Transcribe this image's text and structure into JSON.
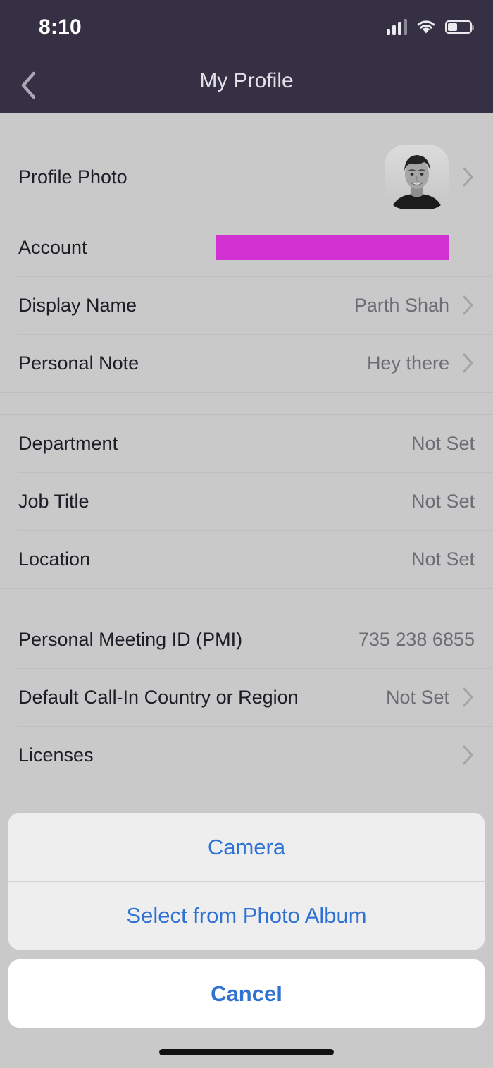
{
  "status_bar": {
    "time": "8:10",
    "icons": [
      "cellular-signal-icon",
      "wifi-icon",
      "battery-icon"
    ],
    "battery_level_percent": 38
  },
  "nav_bar": {
    "title": "My Profile",
    "back_icon": "chevron-left-icon",
    "background_color": "#353043",
    "title_color": "#e3e1e8"
  },
  "colors": {
    "page_background": "#c9c9ca",
    "row_label": "#1d1d26",
    "row_value": "#6c6c74",
    "separator": "#bfbfc1",
    "redaction": "#d031d0",
    "action_link": "#2f72d4",
    "sheet_background": "#eeeeef",
    "cancel_background": "#ffffff"
  },
  "sections": [
    {
      "name": "profile",
      "rows": [
        {
          "label": "Profile Photo",
          "value": "",
          "value_type": "avatar",
          "avatar_alt": "user-profile-photo",
          "chevron": true
        },
        {
          "label": "Account",
          "value": "",
          "value_type": "redacted",
          "chevron": false
        },
        {
          "label": "Display Name",
          "value": "Parth Shah",
          "value_type": "text",
          "chevron": true
        },
        {
          "label": "Personal Note",
          "value": "Hey there",
          "value_type": "text",
          "chevron": true
        }
      ]
    },
    {
      "name": "work-info",
      "rows": [
        {
          "label": "Department",
          "value": "Not Set",
          "value_type": "text",
          "chevron": false
        },
        {
          "label": "Job Title",
          "value": "Not Set",
          "value_type": "text",
          "chevron": false
        },
        {
          "label": "Location",
          "value": "Not Set",
          "value_type": "text",
          "chevron": false
        }
      ]
    },
    {
      "name": "meeting-info",
      "rows": [
        {
          "label": "Personal Meeting ID (PMI)",
          "value": "735 238 6855",
          "value_type": "text",
          "chevron": false
        },
        {
          "label": "Default Call-In Country or Region",
          "value": "Not Set",
          "value_type": "text",
          "chevron": true
        },
        {
          "label": "Licenses",
          "value": "",
          "value_type": "text",
          "chevron": true
        }
      ]
    }
  ],
  "action_sheet": {
    "options": [
      {
        "label": "Camera",
        "name": "camera-option"
      },
      {
        "label": "Select from Photo Album",
        "name": "photo-album-option"
      }
    ],
    "cancel_label": "Cancel"
  }
}
